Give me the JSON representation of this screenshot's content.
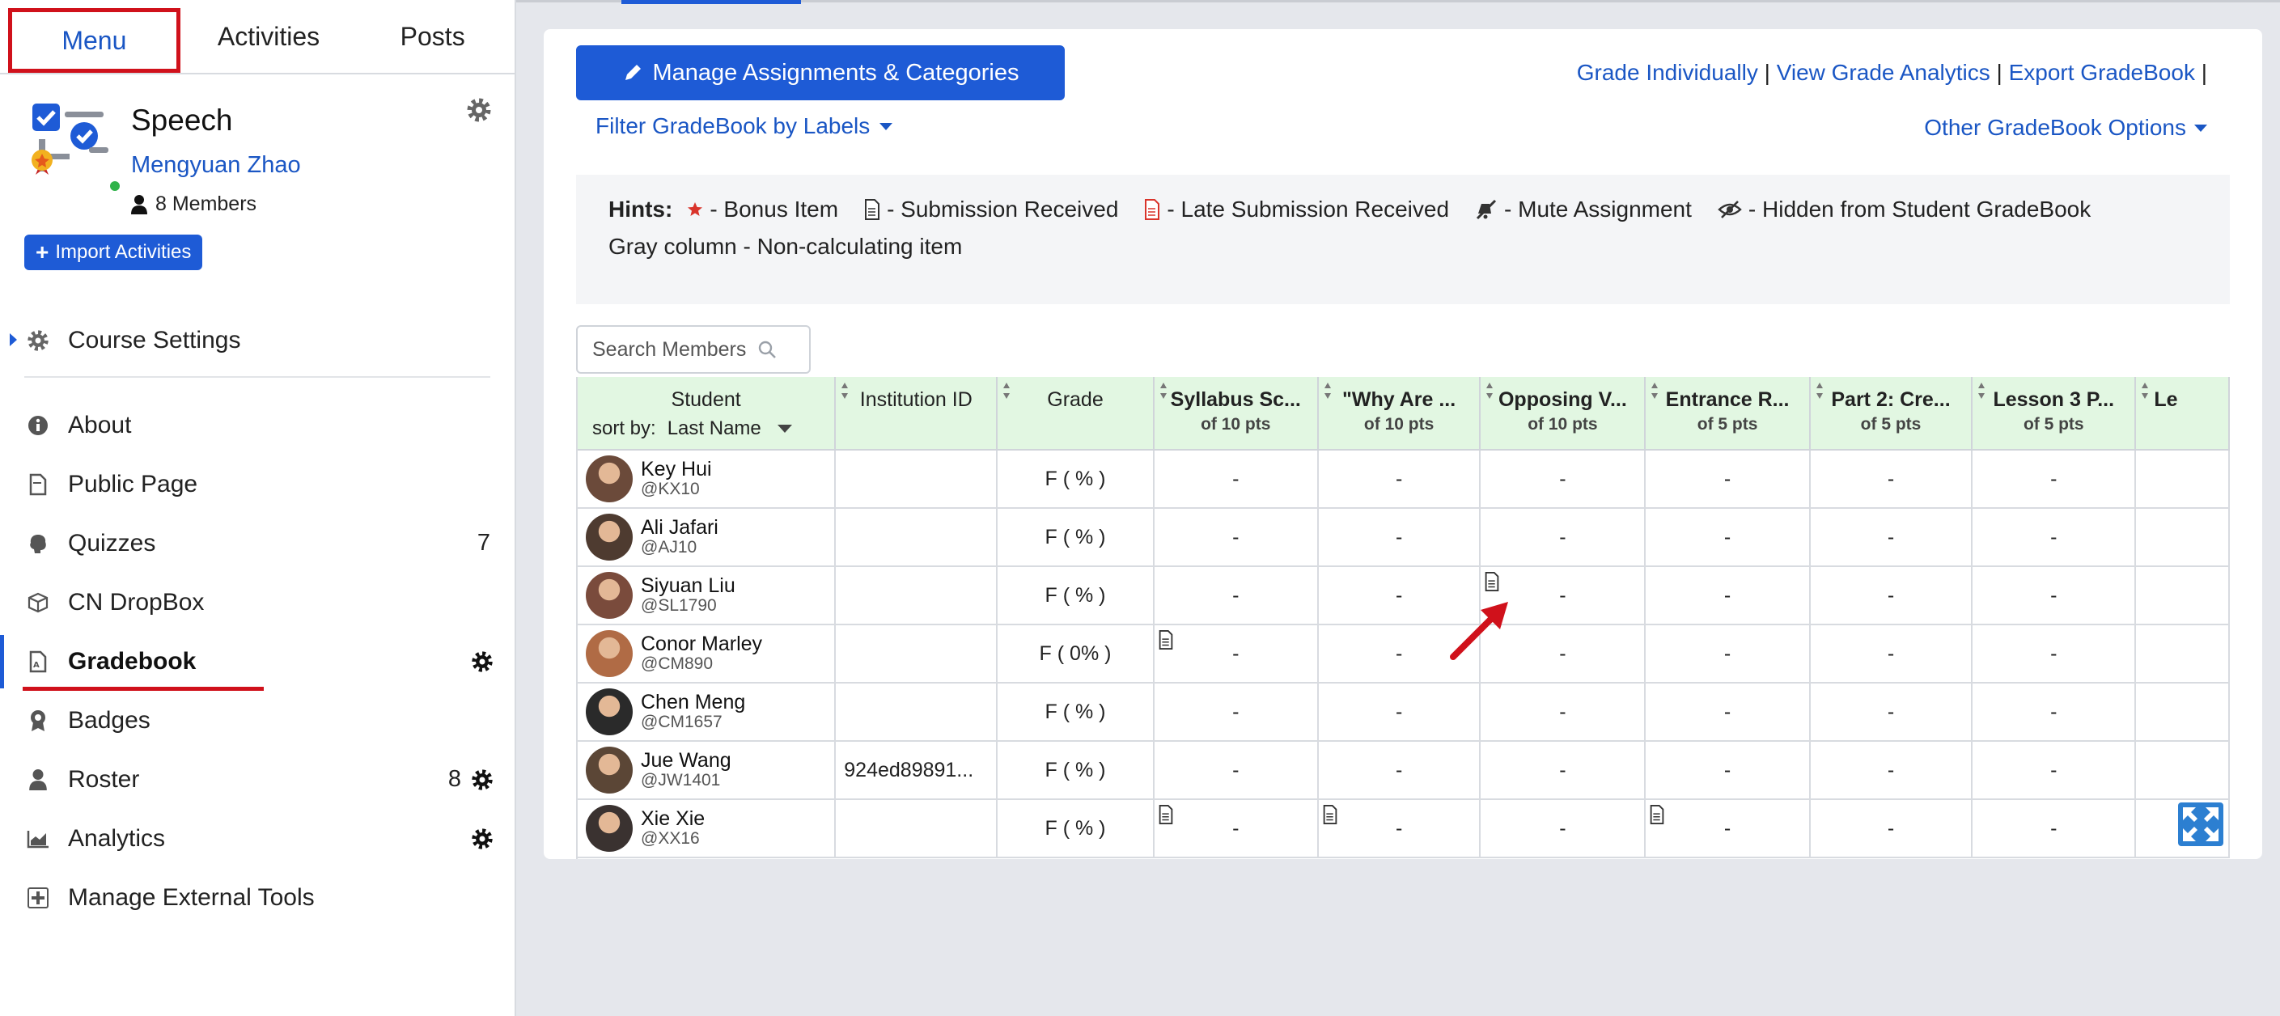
{
  "tabs": [
    "Menu",
    "Activities",
    "Posts"
  ],
  "course": {
    "title": "Speech",
    "owner": "Mengyuan Zhao",
    "members": "8 Members",
    "import_label": "Import Activities"
  },
  "nav": {
    "course_settings": "Course Settings",
    "about": "About",
    "public_page": "Public Page",
    "quizzes": "Quizzes",
    "quizzes_count": "7",
    "dropbox": "CN DropBox",
    "gradebook": "Gradebook",
    "badges": "Badges",
    "roster": "Roster",
    "roster_count": "8",
    "analytics": "Analytics",
    "external_tools": "Manage External Tools"
  },
  "toolbar": {
    "manage_label": "Manage Assignments & Categories",
    "filter_label": "Filter GradeBook by Labels",
    "grade_individually": "Grade Individually",
    "view_analytics": "View Grade Analytics",
    "export": "Export GradeBook",
    "sep": "|",
    "other_options": "Other GradeBook Options"
  },
  "hints": {
    "label": "Hints:",
    "bonus": "- Bonus Item",
    "submission": "- Submission Received",
    "late": "- Late Submission Received",
    "mute": "- Mute Assignment",
    "hidden": "- Hidden from Student GradeBook",
    "gray": "Gray column - Non-calculating item"
  },
  "search": {
    "placeholder": "Search Members"
  },
  "table": {
    "student_header": "Student",
    "sort_by": "sort by:",
    "sort_value": "Last Name",
    "institution_header": "Institution ID",
    "grade_header": "Grade",
    "assignments": [
      {
        "title": "Syllabus Sc...",
        "pts": "of 10 pts"
      },
      {
        "title": "\"Why Are ...",
        "pts": "of 10 pts"
      },
      {
        "title": "Opposing V...",
        "pts": "of 10 pts"
      },
      {
        "title": "Entrance R...",
        "pts": "of 5 pts"
      },
      {
        "title": "Part 2: Cre...",
        "pts": "of 5 pts"
      },
      {
        "title": "Lesson 3 P...",
        "pts": "of 5 pts"
      },
      {
        "title": "Le",
        "pts": ""
      }
    ],
    "rows": [
      {
        "name": "Key Hui",
        "handle": "@KX10",
        "inst": "",
        "grade": "F ( % )",
        "cells": [
          "-",
          "-",
          "-",
          "-",
          "-",
          "-",
          ""
        ]
      },
      {
        "name": "Ali Jafari",
        "handle": "@AJ10",
        "inst": "",
        "grade": "F ( % )",
        "cells": [
          "-",
          "-",
          "-",
          "-",
          "-",
          "-",
          ""
        ]
      },
      {
        "name": "Siyuan Liu",
        "handle": "@SL1790",
        "inst": "",
        "grade": "F ( % )",
        "cells": [
          "-",
          "-",
          "-",
          "-",
          "-",
          "-",
          ""
        ]
      },
      {
        "name": "Conor Marley",
        "handle": "@CM890",
        "inst": "",
        "grade": "F ( 0% )",
        "cells": [
          "-",
          "-",
          "-",
          "-",
          "-",
          "-",
          ""
        ]
      },
      {
        "name": "Chen Meng",
        "handle": "@CM1657",
        "inst": "",
        "grade": "F ( % )",
        "cells": [
          "-",
          "-",
          "-",
          "-",
          "-",
          "-",
          ""
        ]
      },
      {
        "name": "Jue Wang",
        "handle": "@JW1401",
        "inst": "924ed89891...",
        "grade": "F ( % )",
        "cells": [
          "-",
          "-",
          "-",
          "-",
          "-",
          "-",
          ""
        ]
      },
      {
        "name": "Xie Xie",
        "handle": "@XX16",
        "inst": "",
        "grade": "F ( % )",
        "cells": [
          "-",
          "-",
          "-",
          "-",
          "-",
          "-",
          ""
        ]
      }
    ]
  },
  "colors": {
    "accent": "#1e5bd6",
    "link": "#1a56c4",
    "annotation_red": "#d0111b",
    "header_green": "#e2f7e2"
  }
}
